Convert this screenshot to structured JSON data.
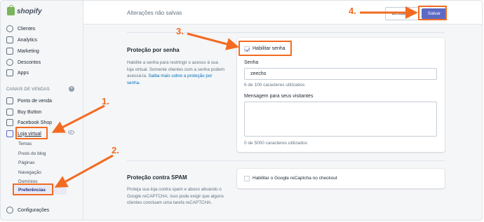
{
  "brand": {
    "name": "shopify",
    "accent": "#5c6ac4",
    "highlight": "#f26b21"
  },
  "sidebar": {
    "items": [
      {
        "label": "Clientes",
        "icon": "customers-icon"
      },
      {
        "label": "Analytics",
        "icon": "analytics-icon"
      },
      {
        "label": "Marketing",
        "icon": "marketing-icon"
      },
      {
        "label": "Descontos",
        "icon": "discounts-icon"
      },
      {
        "label": "Apps",
        "icon": "apps-icon"
      }
    ],
    "channels_label": "CANAIS DE VENDAS",
    "channels": [
      {
        "label": "Ponto de venda",
        "icon": "pos-icon"
      },
      {
        "label": "Buy Button",
        "icon": "buy-button-icon"
      },
      {
        "label": "Facebook Shop",
        "icon": "facebook-icon"
      },
      {
        "label": "Loja virtual",
        "icon": "online-store-icon"
      }
    ],
    "store_subitems": [
      "Temas",
      "Posts do blog",
      "Páginas",
      "Navegação",
      "Domínios",
      "Preferências"
    ],
    "settings_label": "Configurações"
  },
  "topbar": {
    "title": "Alterações não salvas",
    "discard_label": "Descartar",
    "save_label": "Salvar"
  },
  "password_section": {
    "title": "Proteção por senha",
    "description": "Habilite a senha para restringir o acesso à sua loja virtual. Somente clientes com a senha podem acessá-la.",
    "link": "Saiba mais sobre a proteção por senha.",
    "enable_label": "Habilitar senha",
    "enable_checked": true,
    "password_label": "Senha",
    "password_value": "zeecho",
    "password_help": "6 de 100 caracteres utilizados",
    "message_label": "Mensagem para seus visitantes",
    "message_value": "",
    "message_help": "0 de 5000 caracteres utilizados"
  },
  "spam_section": {
    "title": "Proteção contra SPAM",
    "description": "Proteja sua loja contra spam e abuso ativando o Google reCAPTCHA. Isso pode exigir que alguns clientes concluam uma tarefa reCAPTCHA.",
    "recaptcha_label": "Habilitar o Google reCaptcha no checkout",
    "recaptcha_checked": false
  },
  "annotations": {
    "step1": "1.",
    "step2": "2.",
    "step3": "3.",
    "step4": "4."
  }
}
